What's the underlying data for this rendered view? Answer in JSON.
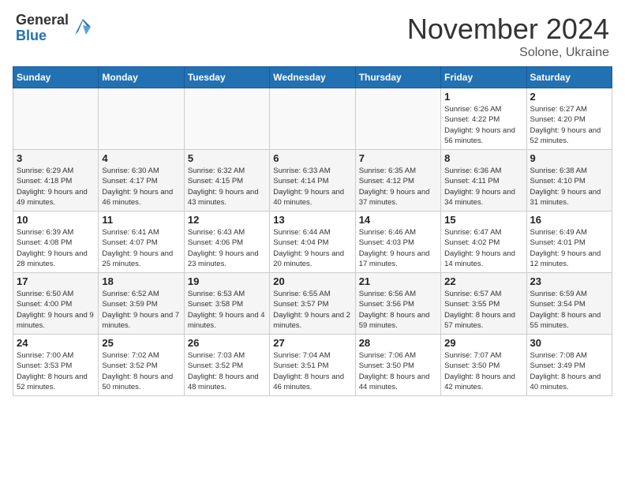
{
  "logo": {
    "general": "General",
    "blue": "Blue"
  },
  "title": {
    "month": "November 2024",
    "location": "Solone, Ukraine"
  },
  "weekdays": [
    "Sunday",
    "Monday",
    "Tuesday",
    "Wednesday",
    "Thursday",
    "Friday",
    "Saturday"
  ],
  "weeks": [
    [
      {
        "day": "",
        "info": ""
      },
      {
        "day": "",
        "info": ""
      },
      {
        "day": "",
        "info": ""
      },
      {
        "day": "",
        "info": ""
      },
      {
        "day": "",
        "info": ""
      },
      {
        "day": "1",
        "info": "Sunrise: 6:26 AM\nSunset: 4:22 PM\nDaylight: 9 hours and 56 minutes."
      },
      {
        "day": "2",
        "info": "Sunrise: 6:27 AM\nSunset: 4:20 PM\nDaylight: 9 hours and 52 minutes."
      }
    ],
    [
      {
        "day": "3",
        "info": "Sunrise: 6:29 AM\nSunset: 4:18 PM\nDaylight: 9 hours and 49 minutes."
      },
      {
        "day": "4",
        "info": "Sunrise: 6:30 AM\nSunset: 4:17 PM\nDaylight: 9 hours and 46 minutes."
      },
      {
        "day": "5",
        "info": "Sunrise: 6:32 AM\nSunset: 4:15 PM\nDaylight: 9 hours and 43 minutes."
      },
      {
        "day": "6",
        "info": "Sunrise: 6:33 AM\nSunset: 4:14 PM\nDaylight: 9 hours and 40 minutes."
      },
      {
        "day": "7",
        "info": "Sunrise: 6:35 AM\nSunset: 4:12 PM\nDaylight: 9 hours and 37 minutes."
      },
      {
        "day": "8",
        "info": "Sunrise: 6:36 AM\nSunset: 4:11 PM\nDaylight: 9 hours and 34 minutes."
      },
      {
        "day": "9",
        "info": "Sunrise: 6:38 AM\nSunset: 4:10 PM\nDaylight: 9 hours and 31 minutes."
      }
    ],
    [
      {
        "day": "10",
        "info": "Sunrise: 6:39 AM\nSunset: 4:08 PM\nDaylight: 9 hours and 28 minutes."
      },
      {
        "day": "11",
        "info": "Sunrise: 6:41 AM\nSunset: 4:07 PM\nDaylight: 9 hours and 25 minutes."
      },
      {
        "day": "12",
        "info": "Sunrise: 6:43 AM\nSunset: 4:06 PM\nDaylight: 9 hours and 23 minutes."
      },
      {
        "day": "13",
        "info": "Sunrise: 6:44 AM\nSunset: 4:04 PM\nDaylight: 9 hours and 20 minutes."
      },
      {
        "day": "14",
        "info": "Sunrise: 6:46 AM\nSunset: 4:03 PM\nDaylight: 9 hours and 17 minutes."
      },
      {
        "day": "15",
        "info": "Sunrise: 6:47 AM\nSunset: 4:02 PM\nDaylight: 9 hours and 14 minutes."
      },
      {
        "day": "16",
        "info": "Sunrise: 6:49 AM\nSunset: 4:01 PM\nDaylight: 9 hours and 12 minutes."
      }
    ],
    [
      {
        "day": "17",
        "info": "Sunrise: 6:50 AM\nSunset: 4:00 PM\nDaylight: 9 hours and 9 minutes."
      },
      {
        "day": "18",
        "info": "Sunrise: 6:52 AM\nSunset: 3:59 PM\nDaylight: 9 hours and 7 minutes."
      },
      {
        "day": "19",
        "info": "Sunrise: 6:53 AM\nSunset: 3:58 PM\nDaylight: 9 hours and 4 minutes."
      },
      {
        "day": "20",
        "info": "Sunrise: 6:55 AM\nSunset: 3:57 PM\nDaylight: 9 hours and 2 minutes."
      },
      {
        "day": "21",
        "info": "Sunrise: 6:56 AM\nSunset: 3:56 PM\nDaylight: 8 hours and 59 minutes."
      },
      {
        "day": "22",
        "info": "Sunrise: 6:57 AM\nSunset: 3:55 PM\nDaylight: 8 hours and 57 minutes."
      },
      {
        "day": "23",
        "info": "Sunrise: 6:59 AM\nSunset: 3:54 PM\nDaylight: 8 hours and 55 minutes."
      }
    ],
    [
      {
        "day": "24",
        "info": "Sunrise: 7:00 AM\nSunset: 3:53 PM\nDaylight: 8 hours and 52 minutes."
      },
      {
        "day": "25",
        "info": "Sunrise: 7:02 AM\nSunset: 3:52 PM\nDaylight: 8 hours and 50 minutes."
      },
      {
        "day": "26",
        "info": "Sunrise: 7:03 AM\nSunset: 3:52 PM\nDaylight: 8 hours and 48 minutes."
      },
      {
        "day": "27",
        "info": "Sunrise: 7:04 AM\nSunset: 3:51 PM\nDaylight: 8 hours and 46 minutes."
      },
      {
        "day": "28",
        "info": "Sunrise: 7:06 AM\nSunset: 3:50 PM\nDaylight: 8 hours and 44 minutes."
      },
      {
        "day": "29",
        "info": "Sunrise: 7:07 AM\nSunset: 3:50 PM\nDaylight: 8 hours and 42 minutes."
      },
      {
        "day": "30",
        "info": "Sunrise: 7:08 AM\nSunset: 3:49 PM\nDaylight: 8 hours and 40 minutes."
      }
    ]
  ]
}
